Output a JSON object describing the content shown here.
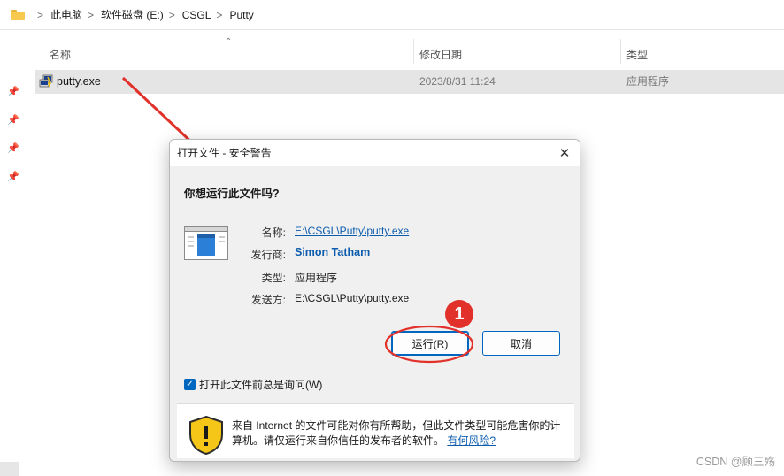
{
  "address_bar": {
    "breadcrumbs": [
      "此电脑",
      "软件磁盘 (E:)",
      "CSGL",
      "Putty"
    ],
    "separator": ">"
  },
  "columns": {
    "name": "名称",
    "date": "修改日期",
    "type": "类型"
  },
  "file": {
    "name": "putty.exe",
    "date": "2023/8/31 11:24",
    "type": "应用程序",
    "icon": "putty-app-icon"
  },
  "dialog": {
    "title": "打开文件 - 安全警告",
    "close_glyph": "✕",
    "question": "你想运行此文件吗?",
    "fields": {
      "name_label": "名称:",
      "name_value": "E:\\CSGL\\Putty\\putty.exe",
      "publisher_label": "发行商:",
      "publisher_value": "Simon Tatham",
      "type_label": "类型:",
      "type_value": "应用程序",
      "from_label": "发送方:",
      "from_value": "E:\\CSGL\\Putty\\putty.exe"
    },
    "run_button": "运行(R)",
    "cancel_button": "取消",
    "checkbox": {
      "label": "打开此文件前总是询问(W)",
      "checked": true
    },
    "warning": {
      "text": "来自 Internet 的文件可能对你有所帮助，但此文件类型可能危害你的计算机。请仅运行来自你信任的发布者的软件。",
      "link": "有何风险?"
    }
  },
  "annotation": {
    "badge_number": "1",
    "color": "#e2312b"
  },
  "watermark": "CSDN @顾三殇",
  "colors": {
    "accent": "#0067c0",
    "link": "#0b5cad",
    "folder": "#f7ca4f",
    "shield": "#f5c518"
  }
}
